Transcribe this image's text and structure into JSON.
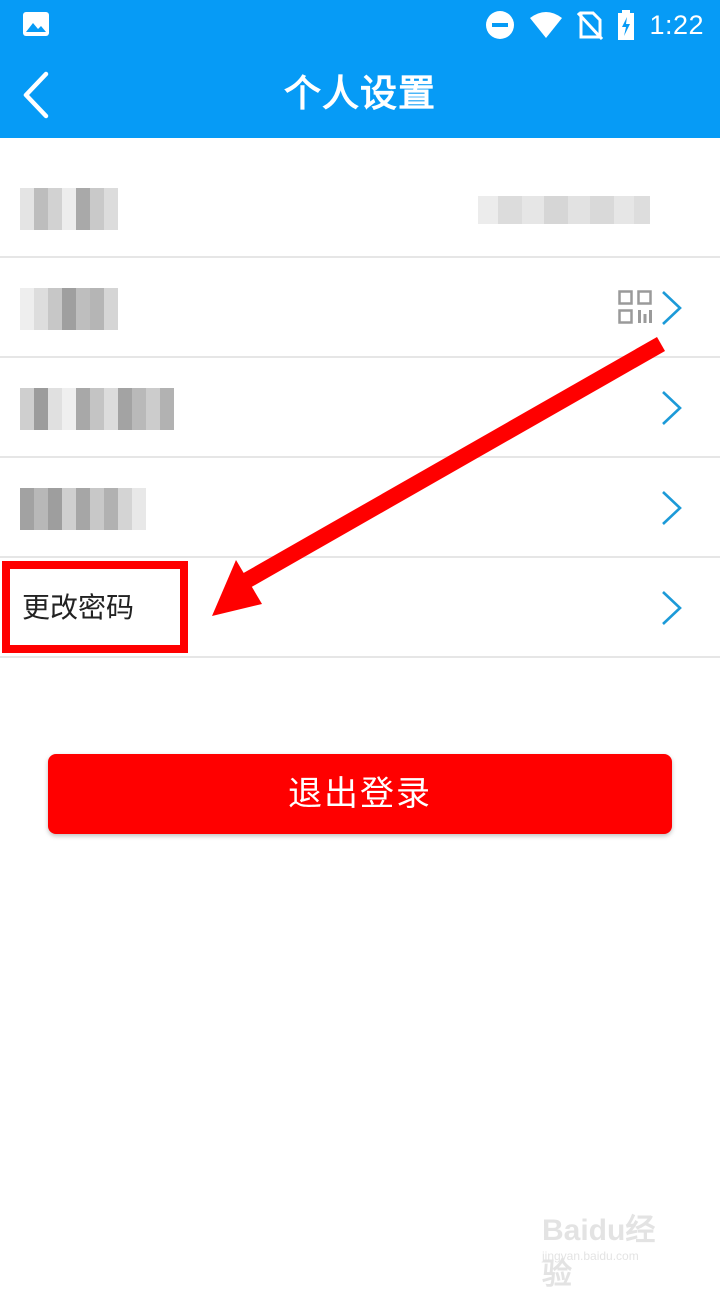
{
  "status_bar": {
    "time": "1:22",
    "icons": [
      "gallery-icon",
      "do-not-disturb-icon",
      "wifi-icon",
      "no-sim-icon",
      "battery-charging-icon"
    ]
  },
  "app_bar": {
    "title": "个人设置",
    "back_icon": "chevron-left-icon"
  },
  "settings_list": {
    "items": [
      {
        "label": "",
        "label_blurred": true,
        "value": "",
        "value_blurred": true,
        "trailing": "none"
      },
      {
        "label": "",
        "label_blurred": true,
        "trailing": "qr-code-icon+chevron"
      },
      {
        "label": "",
        "label_blurred": true,
        "trailing": "chevron"
      },
      {
        "label": "",
        "label_blurred": true,
        "trailing": "chevron"
      },
      {
        "label": "更改密码",
        "label_blurred": false,
        "trailing": "chevron",
        "highlighted": true
      }
    ]
  },
  "logout_button": {
    "label": "退出登录"
  },
  "watermark": {
    "main": "Baidu经验",
    "sub": "jingyan.baidu.com"
  },
  "colors": {
    "header": "#069bf6",
    "chevron": "#1c9ad8",
    "logout": "#ff0000",
    "annotation": "#ff0000",
    "divider": "#e6e6e6"
  }
}
